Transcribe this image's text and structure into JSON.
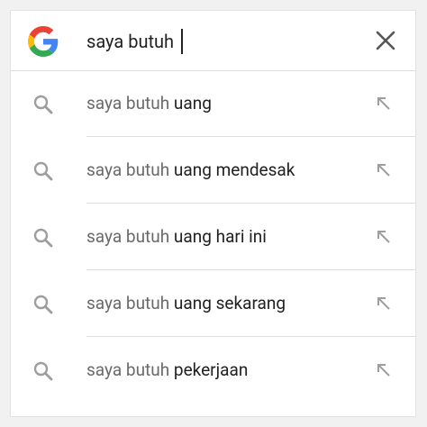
{
  "search": {
    "query": "saya butuh",
    "logo_icon": "google-g-logo",
    "clear_icon": "close-icon"
  },
  "suggestions": [
    {
      "prefix": "saya butuh ",
      "completion": "uang"
    },
    {
      "prefix": "saya butuh ",
      "completion": "uang mendesak"
    },
    {
      "prefix": "saya butuh ",
      "completion": "uang hari ini"
    },
    {
      "prefix": "saya butuh ",
      "completion": "uang sekarang"
    },
    {
      "prefix": "saya butuh ",
      "completion": "pekerjaan"
    }
  ],
  "icons": {
    "suggestion_icon": "search-icon",
    "fill_icon": "arrow-up-left-icon"
  },
  "colors": {
    "google_blue": "#4285F4",
    "google_red": "#EA4335",
    "google_yellow": "#FBBC05",
    "google_green": "#34A853",
    "icon_gray": "#9e9e9e",
    "text_dark": "#212121",
    "text_gray": "#6a6a6a"
  }
}
